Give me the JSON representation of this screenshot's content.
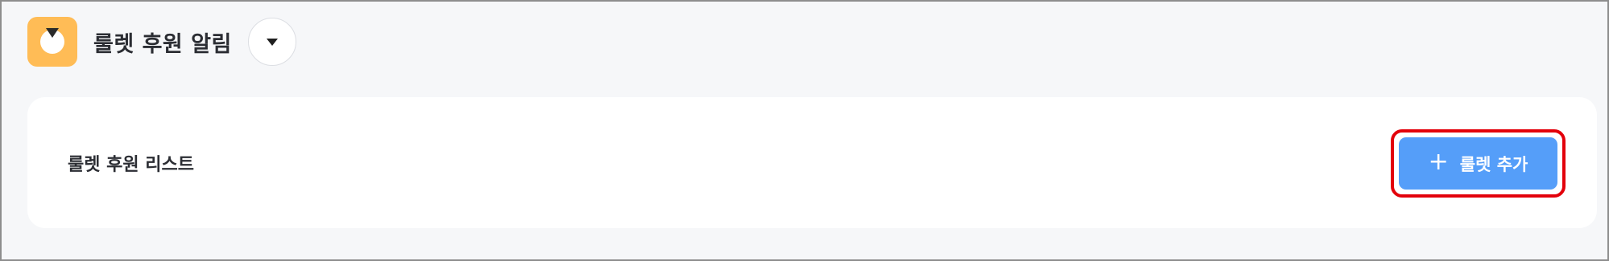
{
  "header": {
    "title": "룰렛 후원 알림",
    "app_icon": "roulette-icon",
    "dropdown_icon": "caret-down-icon"
  },
  "card": {
    "label": "룰렛 후원 리스트",
    "add_button": {
      "label": "룰렛 추가",
      "icon": "plus-icon",
      "icon_glyph": "+"
    }
  },
  "colors": {
    "accent": "#559ef9",
    "app_icon_bg": "#ffbc56",
    "highlight": "#e3000b",
    "page_bg": "#f6f7f9"
  }
}
